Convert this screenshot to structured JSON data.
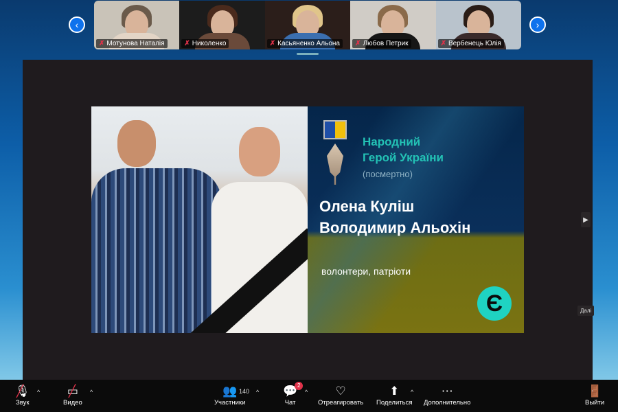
{
  "participants": [
    {
      "name": "Мотунова Наталія",
      "hair": "#6a5a4a",
      "bg": "#c9c3b8",
      "shirt": "#e3d5c6"
    },
    {
      "name": "Николенко",
      "hair": "#4a2a1c",
      "bg": "#1c1c1c",
      "shirt": "#6a4a3a"
    },
    {
      "name": "Касьяненко Альона",
      "hair": "#e0c58a",
      "bg": "#2b1e1a",
      "shirt": "#3b6fb0"
    },
    {
      "name": "Любов Петрик",
      "hair": "#8a6a4a",
      "bg": "#d0ccc6",
      "shirt": "#161616"
    },
    {
      "name": "Вербенець Юлія",
      "hair": "#2a1c16",
      "bg": "#b9c3cc",
      "shirt": "#3a2a2a"
    }
  ],
  "slide": {
    "award_line1": "Народний",
    "award_line2": "Герой України",
    "award_note": "(посмертно)",
    "name1": "Олена Куліш",
    "name2": "Володимир Альохін",
    "roles": "волонтери, патріоти",
    "logo": "Є",
    "ribbon_colors": [
      "#1f4fa8",
      "#f2c00c"
    ]
  },
  "share": {
    "next_label": "Далі"
  },
  "toolbar": {
    "audio": "Звук",
    "video": "Видео",
    "participants": "Участники",
    "participants_count": "140",
    "chat": "Чат",
    "chat_badge": "2",
    "react": "Отреагировать",
    "share": "Поделиться",
    "more": "Дополнительно",
    "leave": "Выйти"
  }
}
